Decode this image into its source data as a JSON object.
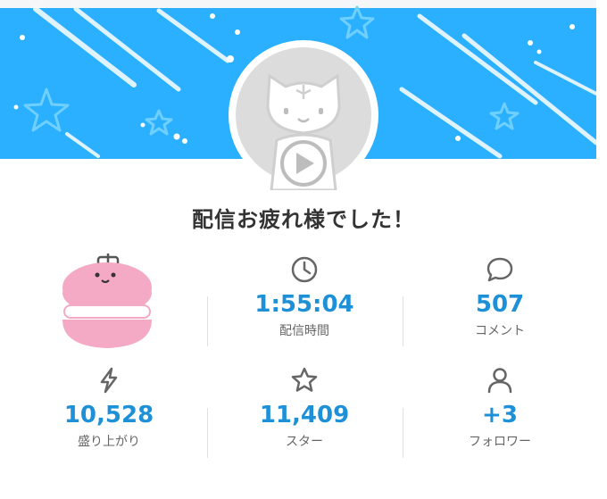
{
  "title": "配信お疲れ様でした！",
  "colors": {
    "banner": "#2ab0ff",
    "accent": "#1e90d8",
    "label": "#666666",
    "icon": "#666666",
    "macaron_pink": "#f4a9c4"
  },
  "stats": {
    "duration": {
      "icon": "clock-icon",
      "value": "1:55:04",
      "label": "配信時間"
    },
    "comments": {
      "icon": "speech-bubble-icon",
      "value": "507",
      "label": "コメント"
    },
    "excitement": {
      "icon": "lightning-icon",
      "value": "10,528",
      "label": "盛り上がり"
    },
    "stars": {
      "icon": "star-icon",
      "value": "11,409",
      "label": "スター"
    },
    "followers": {
      "icon": "person-icon",
      "value": "+3",
      "label": "フォロワー"
    }
  }
}
